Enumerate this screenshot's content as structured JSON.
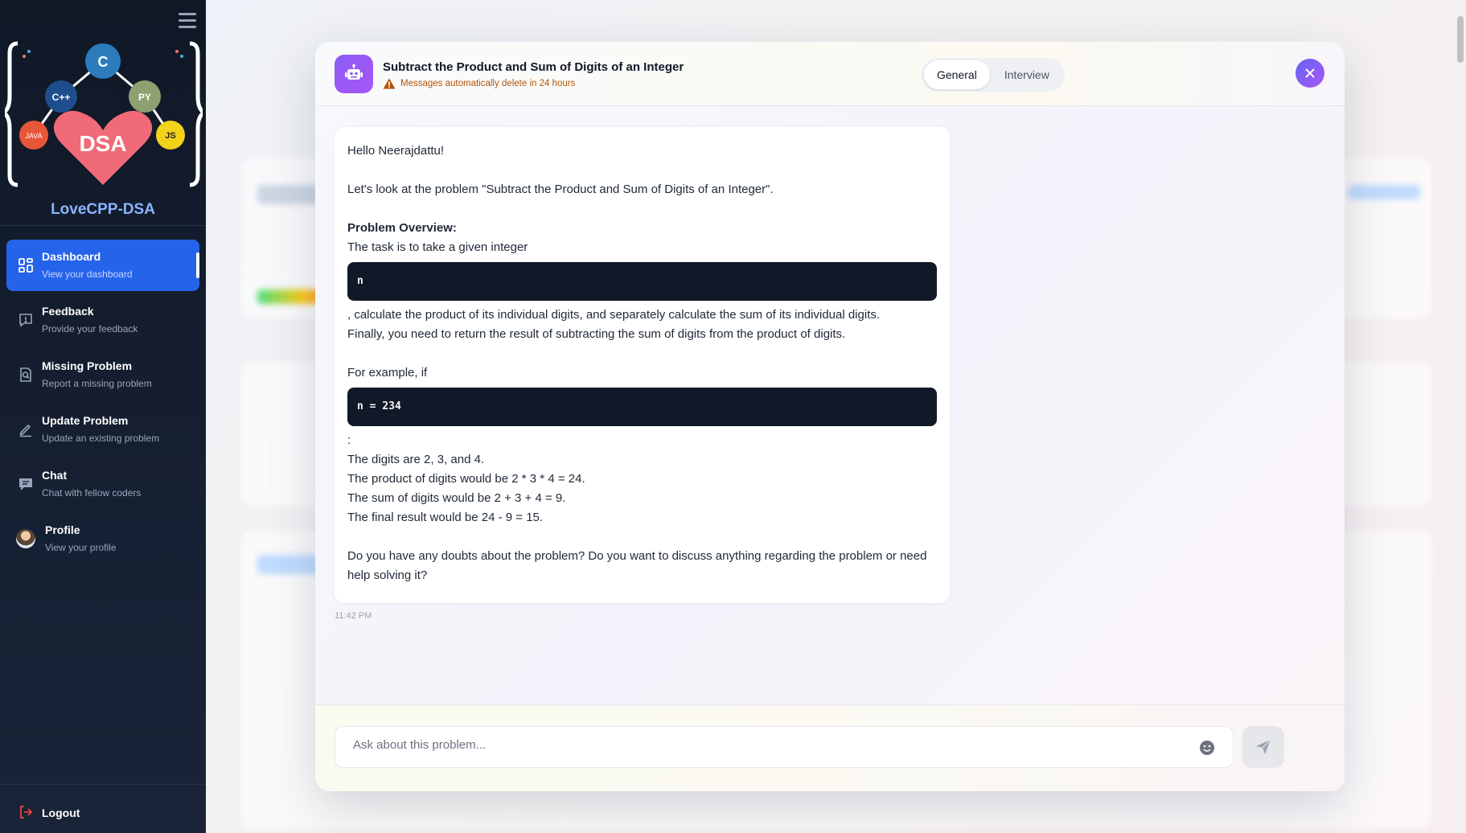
{
  "sidebar": {
    "brand": "LoveCPP-DSA",
    "logo": {
      "center": "DSA",
      "nodes": [
        "C",
        "C++",
        "PY",
        "JAVA",
        "JS"
      ]
    },
    "items": [
      {
        "title": "Dashboard",
        "subtitle": "View your dashboard",
        "icon": "dashboard-icon",
        "active": true
      },
      {
        "title": "Feedback",
        "subtitle": "Provide your feedback",
        "icon": "feedback-icon"
      },
      {
        "title": "Missing Problem",
        "subtitle": "Report a missing problem",
        "icon": "search-doc-icon"
      },
      {
        "title": "Update Problem",
        "subtitle": "Update an existing problem",
        "icon": "edit-icon"
      },
      {
        "title": "Chat",
        "subtitle": "Chat with fellow coders",
        "icon": "chat-icon"
      },
      {
        "title": "Profile",
        "subtitle": "View your profile",
        "icon": "avatar"
      }
    ],
    "logout": "Logout"
  },
  "modal": {
    "title": "Subtract the Product and Sum of Digits of an Integer",
    "warning": "Messages automatically delete in 24 hours",
    "tabs": [
      {
        "label": "General",
        "active": true
      },
      {
        "label": "Interview",
        "active": false
      }
    ],
    "message": {
      "greeting": "Hello Neerajdattu!",
      "intro": "Let's look at the problem \"Subtract the Product and Sum of Digits of an Integer\".",
      "overview_heading": "Problem Overview:",
      "overview_text": "The task is to take a given integer",
      "code1": "n",
      "after_code1_line1": ", calculate the product of its individual digits, and separately calculate the sum of its individual digits.",
      "after_code1_line2": "Finally, you need to return the result of subtracting the sum of digits from the product of digits.",
      "example_intro": "For example, if",
      "code2": "n = 234",
      "colon": ":",
      "ex_line1": "The digits are 2, 3, and 4.",
      "ex_line2": "The product of digits would be 2 * 3 * 4 = 24.",
      "ex_line3": "The sum of digits would be 2 + 3 + 4 = 9.",
      "ex_line4": "The final result would be 24 - 9 = 15.",
      "closing": "Do you have any doubts about the problem? Do you want to discuss anything regarding the problem or need help solving it?",
      "time": "11:42 PM"
    },
    "input": {
      "placeholder": "Ask about this problem..."
    }
  },
  "colors": {
    "accent": "#2563eb",
    "sidebar_bg": "#101826",
    "bot": "#8b5cf6",
    "warning": "#b45309"
  }
}
